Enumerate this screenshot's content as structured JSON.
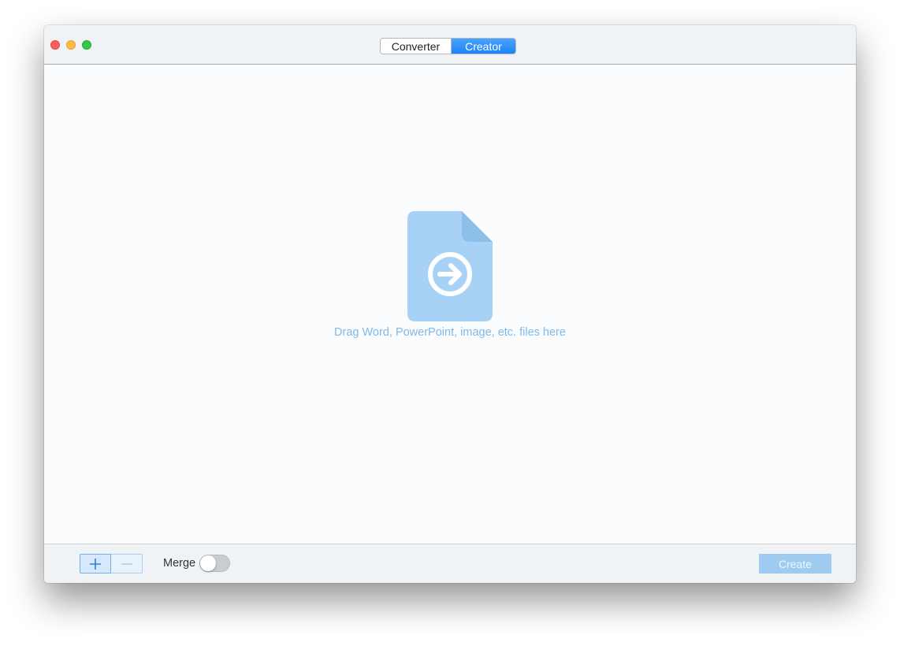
{
  "titlebar": {
    "tabs": [
      {
        "label": "Converter",
        "selected": false
      },
      {
        "label": "Creator",
        "selected": true
      }
    ]
  },
  "drop_zone": {
    "icon": "file-arrow-icon",
    "text": "Drag Word, PowerPoint, image, etc. files here"
  },
  "bottombar": {
    "add_icon": "plus-icon",
    "remove_icon": "minus-icon",
    "merge_label": "Merge",
    "merge_enabled": false,
    "create_label": "Create"
  },
  "colors": {
    "accent": "#1c83f5",
    "icon_fill": "#a8d1f6",
    "text_hint": "#7fb9ea",
    "create_disabled": "#9fcbf1"
  }
}
